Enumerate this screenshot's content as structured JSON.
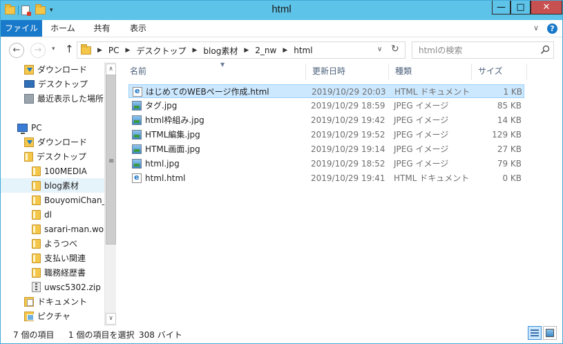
{
  "window": {
    "title": "html"
  },
  "titlebar": {
    "quick_access_dropdown": "▾",
    "minimize_glyph": "—",
    "maximize_glyph": "□",
    "close_glyph": "✕"
  },
  "ribbon": {
    "tabs": [
      {
        "label": "ファイル"
      },
      {
        "label": "ホーム"
      },
      {
        "label": "共有"
      },
      {
        "label": "表示"
      }
    ],
    "collapse_glyph": "∨",
    "help_glyph": "?"
  },
  "nav": {
    "back_glyph": "←",
    "forward_glyph": "→",
    "recent_glyph": "▾",
    "up_glyph": "↑",
    "refresh_glyph": "↻",
    "addr_dropdown_glyph": "∨",
    "crumb_sep": "▶",
    "breadcrumbs": [
      "PC",
      "デスクトップ",
      "blog素材",
      "2_nw",
      "html"
    ]
  },
  "search": {
    "placeholder": "htmlの検索"
  },
  "navpane": {
    "items": [
      {
        "label": "ダウンロード",
        "icon": "download-folder-icon"
      },
      {
        "label": "デスクトップ",
        "icon": "desktop-icon"
      },
      {
        "label": "最近表示した場所",
        "icon": "recent-places-icon"
      },
      {
        "label": "PC",
        "icon": "pc-icon"
      },
      {
        "label": "ダウンロード",
        "icon": "download-folder-icon"
      },
      {
        "label": "デスクトップ",
        "icon": "desktop-folder-icon"
      },
      {
        "label": "100MEDIA",
        "icon": "folder-icon"
      },
      {
        "label": "blog素材",
        "icon": "folder-icon",
        "selected": true
      },
      {
        "label": "BouyomiChan_",
        "icon": "folder-icon"
      },
      {
        "label": "dl",
        "icon": "folder-icon"
      },
      {
        "label": "sarari-man.wo",
        "icon": "folder-icon"
      },
      {
        "label": "ようつべ",
        "icon": "folder-icon"
      },
      {
        "label": "支払い関連",
        "icon": "folder-icon"
      },
      {
        "label": "職務経歴書",
        "icon": "folder-icon"
      },
      {
        "label": "uwsc5302.zip",
        "icon": "zip-icon"
      },
      {
        "label": "ドキュメント",
        "icon": "documents-icon"
      },
      {
        "label": "ピクチャ",
        "icon": "pictures-icon"
      }
    ]
  },
  "scrollbar": {
    "up_glyph": "∧",
    "down_glyph": "∨",
    "grip_glyph": "≡"
  },
  "columns": {
    "name": "名前",
    "date": "更新日時",
    "type": "種類",
    "size": "サイズ",
    "sort_glyph": "▼"
  },
  "files": [
    {
      "name": "はじめてのWEBページ作成.html",
      "date": "2019/10/29 20:03",
      "type": "HTML ドキュメント",
      "size": "1 KB",
      "icon": "html-file-icon",
      "selected": true
    },
    {
      "name": "タグ.jpg",
      "date": "2019/10/29 18:59",
      "type": "JPEG イメージ",
      "size": "85 KB",
      "icon": "image-file-icon"
    },
    {
      "name": "html枠組み.jpg",
      "date": "2019/10/29 19:42",
      "type": "JPEG イメージ",
      "size": "14 KB",
      "icon": "image-file-icon"
    },
    {
      "name": "HTML編集.jpg",
      "date": "2019/10/29 19:52",
      "type": "JPEG イメージ",
      "size": "129 KB",
      "icon": "image-file-icon"
    },
    {
      "name": "HTML画面.jpg",
      "date": "2019/10/29 19:14",
      "type": "JPEG イメージ",
      "size": "27 KB",
      "icon": "image-file-icon"
    },
    {
      "name": "html.jpg",
      "date": "2019/10/29 18:52",
      "type": "JPEG イメージ",
      "size": "79 KB",
      "icon": "image-file-icon"
    },
    {
      "name": "html.html",
      "date": "2019/10/29 19:41",
      "type": "HTML ドキュメント",
      "size": "0 KB",
      "icon": "html-file-icon"
    }
  ],
  "status": {
    "item_count": "7 個の項目",
    "selection": "1 個の項目を選択",
    "selection_size": "308 バイト"
  },
  "colors": {
    "titlebar": "#5ec3e8",
    "file_tab": "#1979ca",
    "selection": "#cce8ff",
    "nav_selection": "#e5f3fb"
  }
}
